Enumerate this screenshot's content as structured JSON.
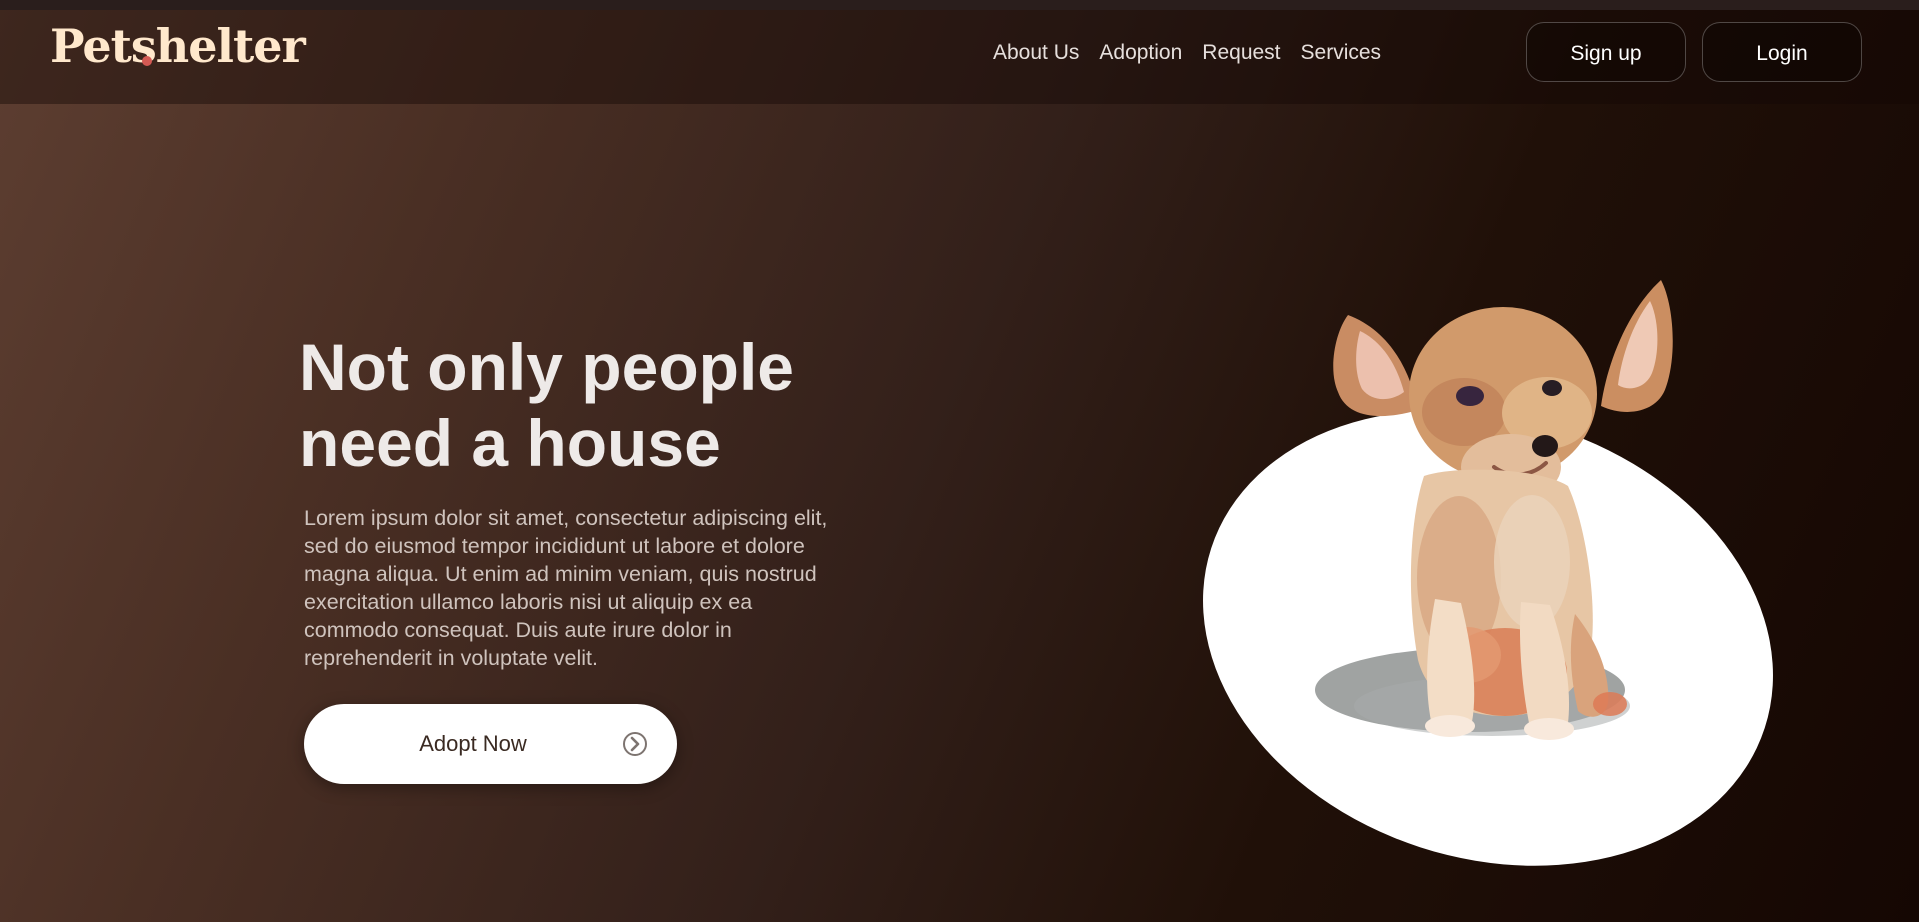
{
  "brand": {
    "name": "Petshelter"
  },
  "nav": {
    "links": [
      "About Us",
      "Adoption",
      "Request",
      "Services"
    ]
  },
  "header": {
    "signup_label": "Sign up",
    "login_label": "Login"
  },
  "hero": {
    "title": "Not only people need a house",
    "description": "Lorem ipsum dolor sit amet, consectetur adipiscing elit, sed do eiusmod tempor incididunt ut labore et dolore magna aliqua. Ut enim ad minim veniam, quis nostrud exercitation ullamco laboris nisi ut aliquip ex ea commodo consequat. Duis aute irure dolor in reprehenderit in voluptate velit.",
    "cta_label": "Adopt Now"
  },
  "icons": {
    "cta": "arrow-right-circle-icon"
  },
  "colors": {
    "logo_accent": "#d45a54",
    "text_light": "#eeeae8",
    "cta_bg": "#ffffff",
    "background_start": "#5d3e31",
    "background_end": "#150703"
  }
}
